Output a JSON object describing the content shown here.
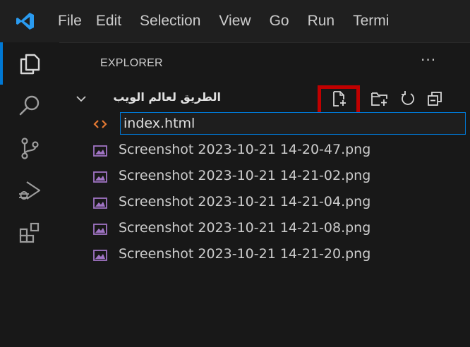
{
  "menu": [
    "File",
    "Edit",
    "Selection",
    "View",
    "Go",
    "Run",
    "Termi"
  ],
  "explorer": {
    "title": "EXPLORER",
    "more": "···",
    "folder_name": "الطريق لعالم الويب",
    "new_file_value": "index.html",
    "files": [
      "Screenshot 2023-10-21 14-20-47.png",
      "Screenshot 2023-10-21 14-21-02.png",
      "Screenshot 2023-10-21 14-21-04.png",
      "Screenshot 2023-10-21 14-21-08.png",
      "Screenshot 2023-10-21 14-21-20.png"
    ]
  },
  "colors": {
    "accent": "#0078d4",
    "highlight": "#c00000",
    "html_icon": "#e37933",
    "image_icon": "#a074c4"
  },
  "icons": [
    "explorer-icon",
    "search-icon",
    "source-control-icon",
    "run-debug-icon",
    "extensions-icon",
    "new-file-icon",
    "new-folder-icon",
    "refresh-icon",
    "collapse-all-icon",
    "chevron-down-icon",
    "html-file-icon",
    "image-file-icon"
  ]
}
